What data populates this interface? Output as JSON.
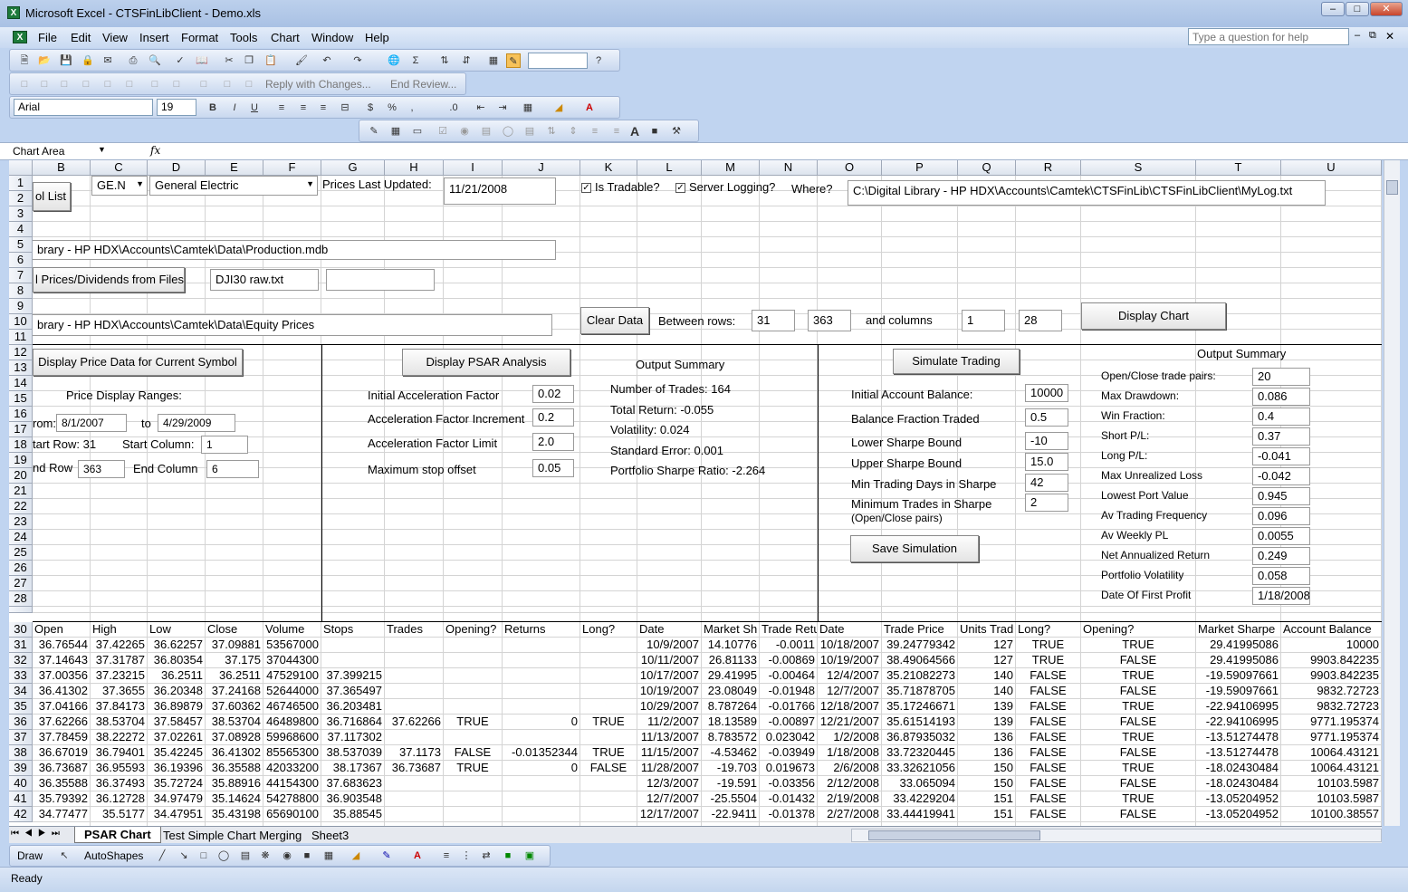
{
  "app": {
    "title": "Microsoft Excel - CTSFinLibClient - Demo.xls",
    "help_placeholder": "Type a question for help",
    "icon": "excel-icon"
  },
  "menu": [
    "File",
    "Edit",
    "View",
    "Insert",
    "Format",
    "Tools",
    "Chart",
    "Window",
    "Help"
  ],
  "toolbar": {
    "review_reply": "Reply with Changes...",
    "review_end": "End Review...",
    "font": "Arial",
    "size": "19"
  },
  "namebox": "Chart Area",
  "columns": [
    "B",
    "C",
    "D",
    "E",
    "F",
    "G",
    "H",
    "I",
    "J",
    "K",
    "L",
    "M",
    "N",
    "O",
    "P",
    "Q",
    "R",
    "S",
    "T",
    "U"
  ],
  "rows": [
    "1",
    "2",
    "3",
    "4",
    "5",
    "6",
    "7",
    "8",
    "9",
    "10",
    "11",
    "12",
    "13",
    "14",
    "15",
    "16",
    "17",
    "18",
    "19",
    "20",
    "21",
    "22",
    "23",
    "24",
    "25",
    "26",
    "27",
    "28",
    "",
    "30",
    "31",
    "32",
    "33",
    "34",
    "35",
    "36",
    "37",
    "38",
    "39",
    "40",
    "41",
    "42"
  ],
  "controls": {
    "symbol_list_btn": "ol List",
    "symbol_combo": "GE.N",
    "company_combo": "General Electric",
    "prices_updated_label": "Prices Last Updated:",
    "prices_updated_value": "11/21/2008",
    "tradable_label": "Is Tradable?",
    "server_log_label": "Server Logging?",
    "where_label": "Where?",
    "log_path": "C:\\Digital Library - HP HDX\\Accounts\\Camtek\\CTSFinLib\\CTSFinLibClient\\MyLog.txt",
    "db_path": "brary - HP HDX\\Accounts\\Camtek\\Data\\Production.mdb",
    "load_prices_btn": "l Prices/Dividends from Files",
    "file_name": "DJI30  raw.txt",
    "file_name2": "",
    "equity_path": "brary - HP HDX\\Accounts\\Camtek\\Data\\Equity Prices",
    "clear_data_btn": "Clear Data",
    "between_rows_label": "Between rows:",
    "row_from": "31",
    "row_to": "363",
    "and_columns_label": "and columns",
    "col_from": "1",
    "col_to": "28",
    "display_chart_btn": "Display Chart"
  },
  "price_panel": {
    "display_btn": "Display Price Data for Current Symbol",
    "ranges_label": "Price Display Ranges:",
    "from_label": "rom:",
    "from": "8/1/2007",
    "to_label": "to",
    "to": "4/29/2009",
    "start_row_label": "tart Row: 31",
    "start_col_label": "Start Column:",
    "start_col": "1",
    "end_row_label": "nd Row",
    "end_row": "363",
    "end_col_label": "End Column",
    "end_col": "6"
  },
  "psar_panel": {
    "display_btn": "Display PSAR Analysis",
    "params": [
      {
        "label": "Initial Acceleration Factor",
        "value": "0.02"
      },
      {
        "label": "Acceleration Factor Increment",
        "value": "0.2"
      },
      {
        "label": "Acceleration Factor Limit",
        "value": "2.0"
      },
      {
        "label": "Maximum stop offset",
        "value": "0.05"
      }
    ],
    "summary_title": "Output Summary",
    "summary": [
      "Number of Trades: 164",
      "Total Return: -0.055",
      "Volatility: 0.024",
      "Standard Error: 0.001",
      "Portfolio Sharpe Ratio: -2.264"
    ]
  },
  "sim_panel": {
    "simulate_btn": "Simulate Trading",
    "params": [
      {
        "label": "Initial Account Balance:",
        "value": "10000"
      },
      {
        "label": "Balance Fraction Traded",
        "value": "0.5"
      },
      {
        "label": "Lower Sharpe Bound",
        "value": "-10"
      },
      {
        "label": "Upper Sharpe Bound",
        "value": "15.0"
      },
      {
        "label": "Min Trading Days in Sharpe",
        "value": "42"
      },
      {
        "label": "Minimum Trades in Sharpe",
        "value": "2"
      }
    ],
    "min_trades_sub": "(Open/Close pairs)",
    "save_btn": "Save Simulation",
    "summary_title": "Output Summary",
    "summary": [
      {
        "label": "Open/Close trade pairs:",
        "value": "20"
      },
      {
        "label": "Max Drawdown:",
        "value": "0.086"
      },
      {
        "label": "Win Fraction:",
        "value": "0.4"
      },
      {
        "label": "Short P/L:",
        "value": "0.37"
      },
      {
        "label": "Long P/L:",
        "value": "-0.041"
      },
      {
        "label": "Max Unrealized Loss",
        "value": "-0.042"
      },
      {
        "label": "Lowest Port Value",
        "value": "0.945"
      },
      {
        "label": "Av Trading Frequency",
        "value": "0.096"
      },
      {
        "label": "Av Weekly PL",
        "value": "0.0055"
      },
      {
        "label": "Net Annualized Return",
        "value": "0.249"
      },
      {
        "label": "Portfolio Volatility",
        "value": "0.058"
      },
      {
        "label": "Date Of First Profit",
        "value": "1/18/2008"
      }
    ]
  },
  "table": {
    "headers": [
      "Open",
      "High",
      "Low",
      "Close",
      "Volume",
      "Stops",
      "Trades",
      "Opening?",
      "Returns",
      "Long?",
      "Date",
      "Market Sh",
      "Trade Retu",
      "Date",
      "Trade Price",
      "Units Trad",
      "Long?",
      "Opening?",
      "Market Sharpe",
      "Account Balance"
    ],
    "rows": [
      [
        "36.76544",
        "37.42265",
        "36.62257",
        "37.09881",
        "53567000",
        "",
        "",
        "",
        "",
        "",
        "10/9/2007",
        "14.10776",
        "-0.0011",
        "10/18/2007",
        "39.24779342",
        "127",
        "TRUE",
        "TRUE",
        "29.41995086",
        "10000"
      ],
      [
        "37.14643",
        "37.31787",
        "36.80354",
        "37.175",
        "37044300",
        "",
        "",
        "",
        "",
        "",
        "10/11/2007",
        "26.81133",
        "-0.00869",
        "10/19/2007",
        "38.49064566",
        "127",
        "TRUE",
        "FALSE",
        "29.41995086",
        "9903.842235"
      ],
      [
        "37.00356",
        "37.23215",
        "36.2511",
        "36.2511",
        "47529100",
        "37.399215",
        "",
        "",
        "",
        "",
        "10/17/2007",
        "29.41995",
        "-0.00464",
        "12/4/2007",
        "35.21082273",
        "140",
        "FALSE",
        "TRUE",
        "-19.59097661",
        "9903.842235"
      ],
      [
        "36.41302",
        "37.3655",
        "36.20348",
        "37.24168",
        "52644000",
        "37.365497",
        "",
        "",
        "",
        "",
        "10/19/2007",
        "23.08049",
        "-0.01948",
        "12/7/2007",
        "35.71878705",
        "140",
        "FALSE",
        "FALSE",
        "-19.59097661",
        "9832.72723"
      ],
      [
        "37.04166",
        "37.84173",
        "36.89879",
        "37.60362",
        "46746500",
        "36.203481",
        "",
        "",
        "",
        "",
        "10/29/2007",
        "8.787264",
        "-0.01766",
        "12/18/2007",
        "35.17246671",
        "139",
        "FALSE",
        "TRUE",
        "-22.94106995",
        "9832.72723"
      ],
      [
        "37.62266",
        "38.53704",
        "37.58457",
        "38.53704",
        "46489800",
        "36.716864",
        "37.62266",
        "TRUE",
        "0",
        "TRUE",
        "11/2/2007",
        "18.13589",
        "-0.00897",
        "12/21/2007",
        "35.61514193",
        "139",
        "FALSE",
        "FALSE",
        "-22.94106995",
        "9771.195374"
      ],
      [
        "37.78459",
        "38.22272",
        "37.02261",
        "37.08928",
        "59968600",
        "37.117302",
        "",
        "",
        "",
        "",
        "11/13/2007",
        "8.783572",
        "0.023042",
        "1/2/2008",
        "36.87935032",
        "136",
        "FALSE",
        "TRUE",
        "-13.51274478",
        "9771.195374"
      ],
      [
        "36.67019",
        "36.79401",
        "35.42245",
        "36.41302",
        "85565300",
        "38.537039",
        "37.1173",
        "FALSE",
        "-0.01352344",
        "TRUE",
        "11/15/2007",
        "-4.53462",
        "-0.03949",
        "1/18/2008",
        "33.72320445",
        "136",
        "FALSE",
        "FALSE",
        "-13.51274478",
        "10064.43121"
      ],
      [
        "36.73687",
        "36.95593",
        "36.19396",
        "36.35588",
        "42033200",
        "38.17367",
        "36.73687",
        "TRUE",
        "0",
        "FALSE",
        "11/28/2007",
        "-19.703",
        "0.019673",
        "2/6/2008",
        "33.32621056",
        "150",
        "FALSE",
        "TRUE",
        "-18.02430484",
        "10064.43121"
      ],
      [
        "36.35588",
        "36.37493",
        "35.72724",
        "35.88916",
        "44154300",
        "37.683623",
        "",
        "",
        "",
        "",
        "12/3/2007",
        "-19.591",
        "-0.03356",
        "2/12/2008",
        "33.065094",
        "150",
        "FALSE",
        "FALSE",
        "-18.02430484",
        "10103.5987"
      ],
      [
        "35.79392",
        "36.12728",
        "34.97479",
        "35.14624",
        "54278800",
        "36.903548",
        "",
        "",
        "",
        "",
        "12/7/2007",
        "-25.5504",
        "-0.01432",
        "2/19/2008",
        "33.4229204",
        "151",
        "FALSE",
        "TRUE",
        "-13.05204952",
        "10103.5987"
      ],
      [
        "34.77477",
        "35.5177",
        "34.47951",
        "35.43198",
        "65690100",
        "35.88545",
        "",
        "",
        "",
        "",
        "12/17/2007",
        "-22.9411",
        "-0.01378",
        "2/27/2008",
        "33.44419941",
        "151",
        "FALSE",
        "FALSE",
        "-13.05204952",
        "10100.38557"
      ]
    ]
  },
  "tabs": [
    "PSAR Chart",
    "Test Simple Chart Merging",
    "Sheet3"
  ],
  "drawbar": {
    "draw": "Draw",
    "autoshapes": "AutoShapes"
  },
  "status": "Ready"
}
